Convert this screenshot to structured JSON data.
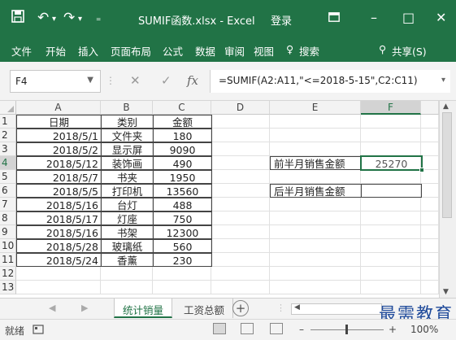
{
  "titlebar": {
    "save_icon": "save-icon",
    "undo_icon": "undo-icon",
    "redo_icon": "redo-icon",
    "customize_icon": "customize-icon",
    "title": "SUMIF函数.xlsx - Excel",
    "login": "登录",
    "ribbon_display_icon": "ribbon-display-icon",
    "minimize": "–",
    "maximize": "□",
    "close": "✕"
  },
  "menu": {
    "items": [
      "文件",
      "开始",
      "插入",
      "页面布局",
      "公式",
      "数据",
      "审阅",
      "视图"
    ],
    "search": "搜索",
    "search_icon": "lightbulb-icon",
    "share": "共享(S)",
    "share_icon": "person-icon"
  },
  "formula_bar": {
    "name_box": "F4",
    "cancel": "✕",
    "enter": "✓",
    "fx": "fx",
    "formula": "=SUMIF(A2:A11,\"<=2018-5-15\",C2:C11)"
  },
  "grid": {
    "columns": [
      "A",
      "B",
      "C",
      "D",
      "E",
      "F"
    ],
    "active_column": "F",
    "row_numbers": [
      "1",
      "2",
      "3",
      "4",
      "5",
      "6",
      "7",
      "8",
      "9",
      "10",
      "11",
      "12",
      "13"
    ],
    "active_row": "4",
    "header_row": [
      "日期",
      "类别",
      "金额"
    ],
    "rows": [
      [
        "2018/5/1",
        "文件夹",
        "180"
      ],
      [
        "2018/5/2",
        "显示屏",
        "9090"
      ],
      [
        "2018/5/12",
        "装饰画",
        "490"
      ],
      [
        "2018/5/7",
        "书夹",
        "1950"
      ],
      [
        "2018/5/5",
        "打印机",
        "13560"
      ],
      [
        "2018/5/16",
        "台灯",
        "488"
      ],
      [
        "2018/5/17",
        "灯座",
        "750"
      ],
      [
        "2018/5/16",
        "书架",
        "12300"
      ],
      [
        "2018/5/28",
        "玻璃纸",
        "560"
      ],
      [
        "2018/5/24",
        "香薰",
        "230"
      ]
    ],
    "summary": {
      "first_half_label": "前半月销售金额",
      "first_half_value": "25270",
      "second_half_label": "后半月销售金额",
      "second_half_value": ""
    },
    "selected_cell": "F4"
  },
  "sheets": {
    "prev": "◀",
    "next": "▶",
    "tabs": [
      "统计销量",
      "工资总额"
    ],
    "active": "统计销量",
    "add": "+"
  },
  "status": {
    "ready": "就绪",
    "zoom": "100%",
    "zoom_minus": "–",
    "zoom_plus": "+"
  },
  "watermark": "最需教育",
  "colors": {
    "excel_green": "#217346",
    "watermark_blue": "#1f4a9a"
  }
}
